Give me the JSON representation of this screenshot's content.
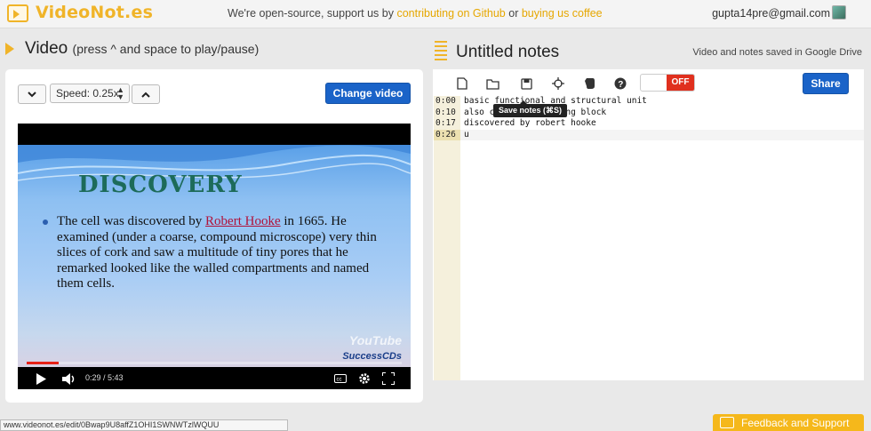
{
  "app": {
    "logo_text": "VideoNot.es"
  },
  "header": {
    "tagline_prefix": "We're open-source, support us by ",
    "link_github": "contributing on Github",
    "tagline_or": " or ",
    "link_coffee": "buying us coffee",
    "user_email": "gupta14pre@gmail.com"
  },
  "video_panel": {
    "title": "Video",
    "hint": "(press ^ and space to play/pause)",
    "speed_label": "Speed: 0.25x",
    "change_video_label": "Change video",
    "player": {
      "slide_title": "DISCOVERY",
      "slide_text_before": "The cell was discovered by ",
      "slide_text_link": "Robert Hooke",
      "slide_text_after": " in 1665. He examined (under a coarse, compound microscope) very thin slices of cork and saw a multitude of tiny pores that he remarked looked like the walled compartments and named them cells.",
      "watermark_1": "YouTube",
      "watermark_2": "SuccessCDs",
      "time_display": "0:29 / 5:43",
      "progress_fraction": 0.0845
    }
  },
  "notes_panel": {
    "title": "Untitled notes",
    "saved_message": "Video and notes saved in Google Drive",
    "toggle_label": "OFF",
    "share_label": "Share",
    "tooltip": "Save notes (⌘S)",
    "toolbar_icons": [
      "new-note-icon",
      "open-folder-icon",
      "save-icon",
      "sync-crosshair-icon",
      "evernote-icon",
      "help-icon"
    ],
    "lines": [
      {
        "time": "0:00",
        "text": "basic functional and structural unit"
      },
      {
        "time": "0:10",
        "text": "also called a building block"
      },
      {
        "time": "0:17",
        "text": "discovered by robert hooke"
      },
      {
        "time": "0:26",
        "text": "u"
      }
    ]
  },
  "status_bar": {
    "url": "www.videonot.es/edit/0Bwap9U8affZ1OHI1SWNWTzlWQUU"
  },
  "feedback": {
    "label": "Feedback and Support"
  },
  "colors": {
    "brand": "#f0b429",
    "primary_button": "#1a63c8",
    "toggle_off": "#e0301e"
  }
}
